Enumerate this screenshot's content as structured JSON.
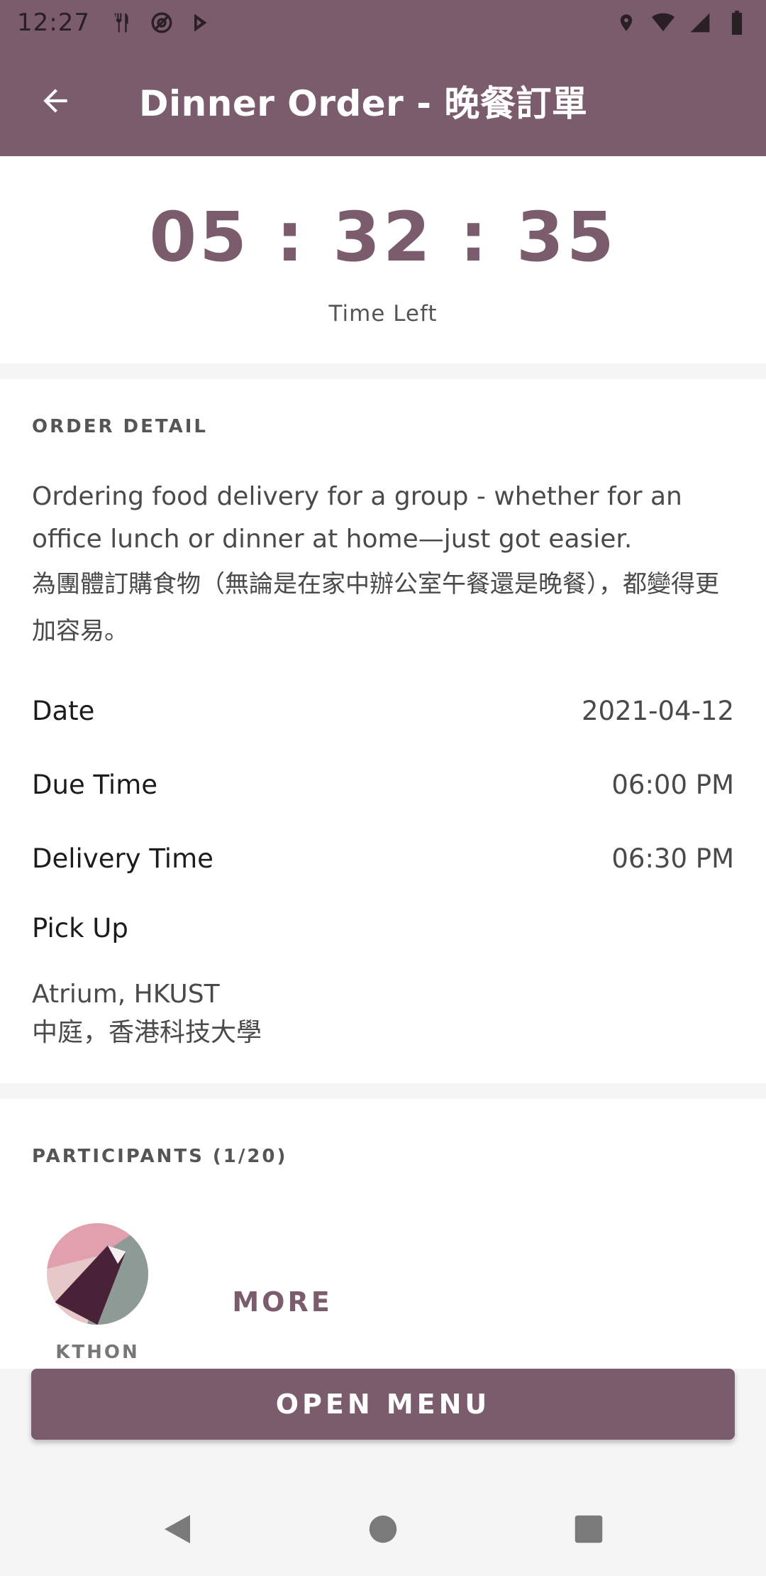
{
  "status_bar": {
    "time": "12:27",
    "left_icons": [
      "restaurant-icon",
      "at-sign-icon",
      "play-store-icon"
    ],
    "right_icons": [
      "location-icon",
      "wifi-icon",
      "signal-icon",
      "battery-icon"
    ]
  },
  "app_bar": {
    "title": "Dinner Order - 晚餐訂單",
    "back_icon": "arrow-left-icon"
  },
  "timer": {
    "value": "05 : 32 : 35",
    "label": "Time Left"
  },
  "order_detail": {
    "heading": "ORDER DETAIL",
    "description_en": "Ordering food delivery for a group - whether for an office lunch or dinner at home—just got easier.",
    "description_zh": "為團體訂購食物（無論是在家中辦公室午餐還是晚餐），都變得更加容易。",
    "rows": [
      {
        "label": "Date",
        "value": "2021-04-12"
      },
      {
        "label": "Due Time",
        "value": "06:00 PM"
      },
      {
        "label": "Delivery Time",
        "value": "06:30 PM"
      }
    ],
    "pickup_label": "Pick Up",
    "pickup_en": "Atrium, HKUST",
    "pickup_zh": "中庭，香港科技大學"
  },
  "participants": {
    "heading": "PARTICIPANTS (1/20)",
    "members": [
      {
        "name": "KTHON"
      }
    ],
    "more_label": "MORE"
  },
  "actions": {
    "open_menu_label": "OPEN MENU"
  },
  "colors": {
    "primary": "#7a5c6c",
    "background": "#f6f5f6",
    "card": "#ffffff"
  }
}
